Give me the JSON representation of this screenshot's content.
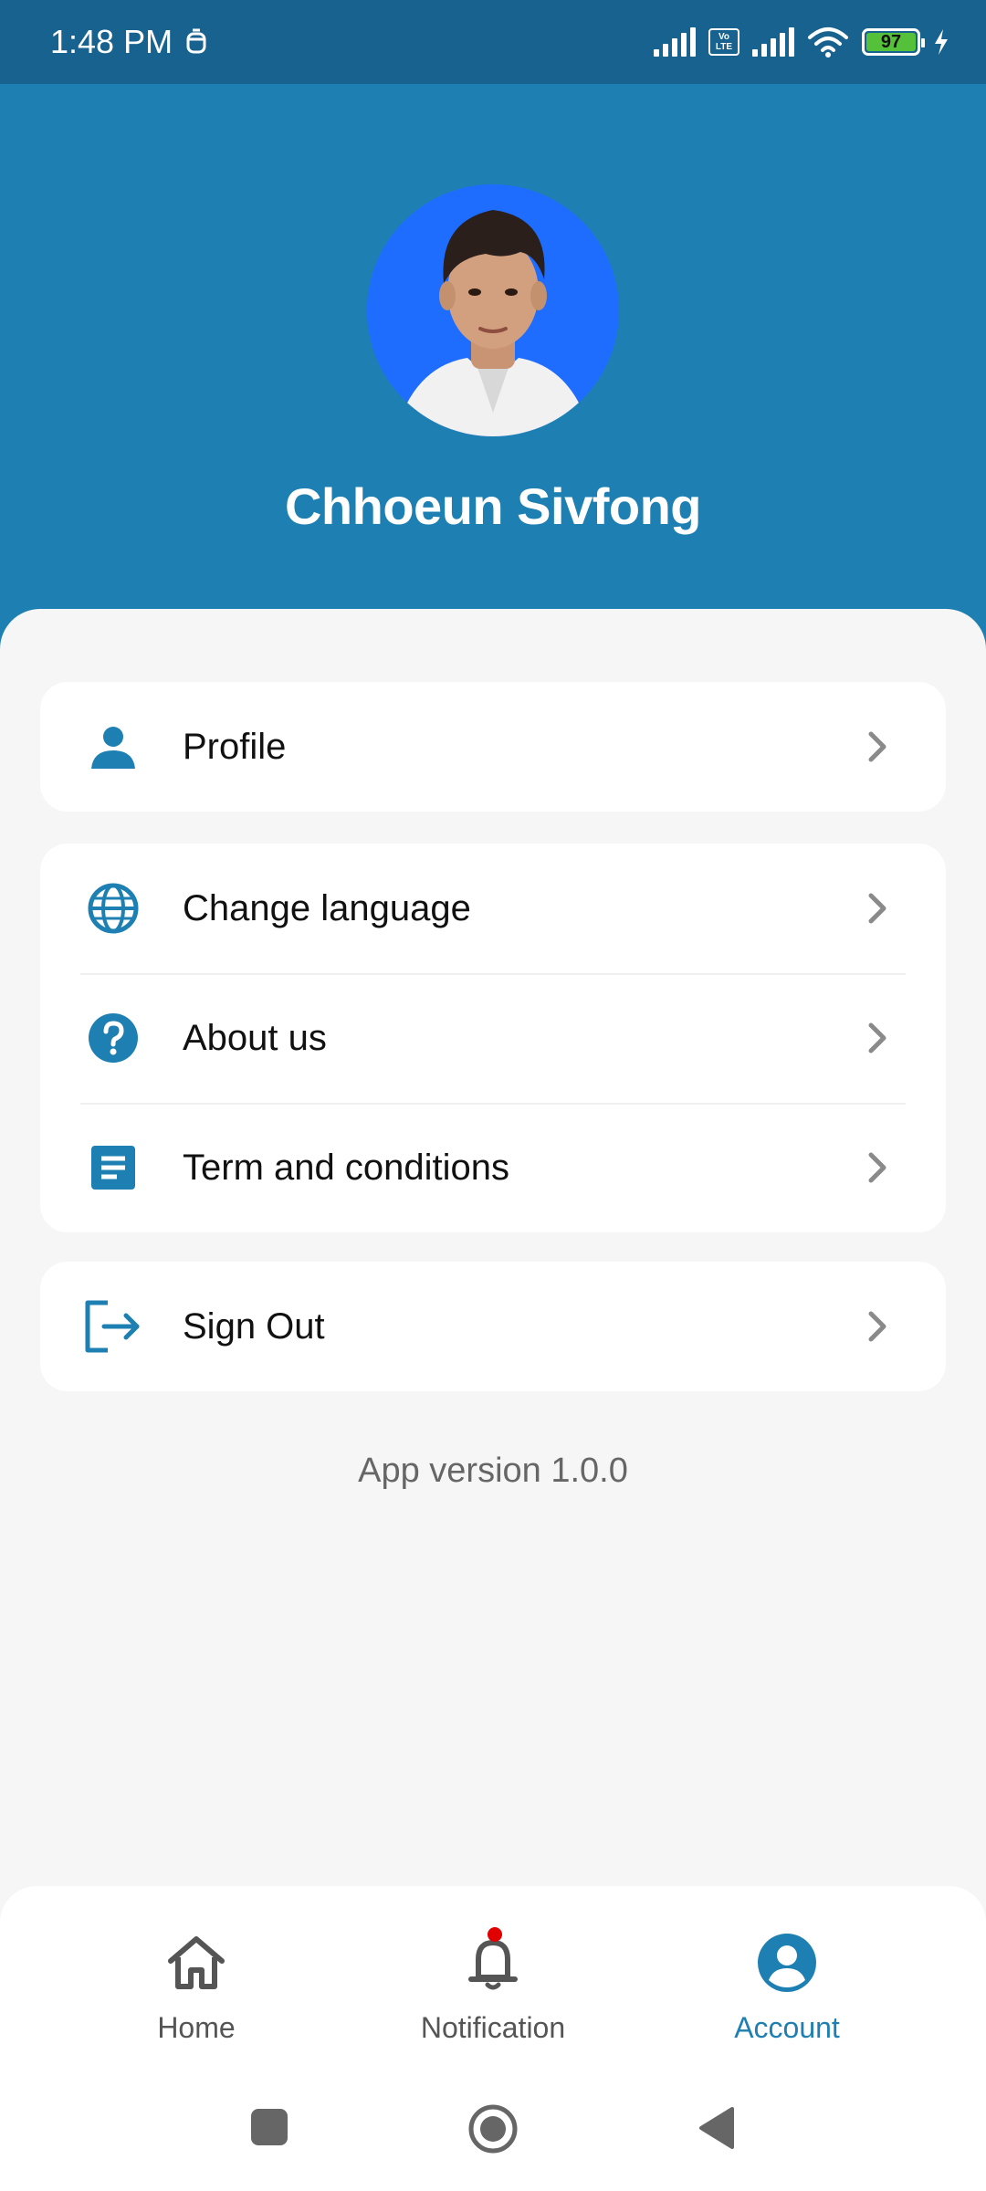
{
  "status_bar": {
    "time": "1:48 PM",
    "volte_label": "Vo LTE",
    "battery": "97"
  },
  "header": {
    "user_name": "Chhoeun Sivfong",
    "avatar_icon": "user-avatar-photo"
  },
  "menu": {
    "profile": {
      "label": "Profile",
      "icon": "person-icon"
    },
    "change_language": {
      "label": "Change language",
      "icon": "globe-icon"
    },
    "about_us": {
      "label": "About us",
      "icon": "help-circle-icon"
    },
    "terms": {
      "label": "Term and conditions",
      "icon": "document-icon"
    },
    "sign_out": {
      "label": "Sign Out",
      "icon": "logout-icon"
    }
  },
  "app_version": "App version 1.0.0",
  "bottom_nav": {
    "home": "Home",
    "notification": "Notification",
    "account": "Account",
    "active": "account"
  },
  "colors": {
    "primary": "#1e80b2",
    "status_bar": "#17628f",
    "background": "#f6f6f6",
    "notification_dot": "#e00000"
  }
}
